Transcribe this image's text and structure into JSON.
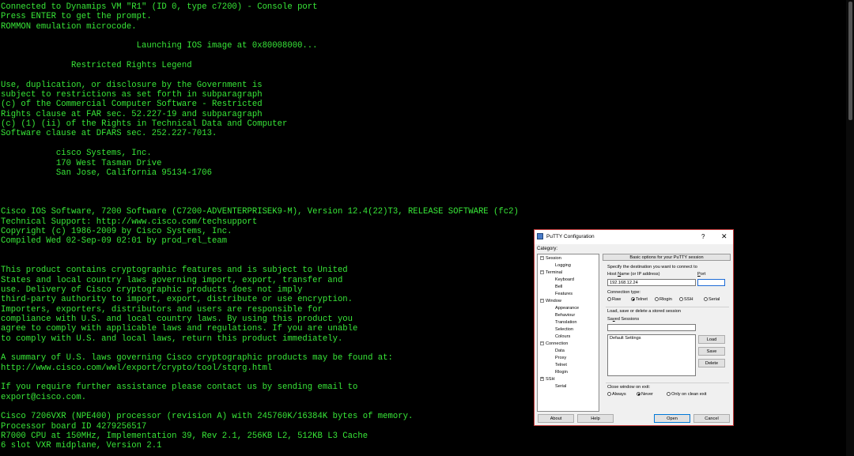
{
  "terminal": {
    "lines": [
      "Connected to Dynamips VM \"R1\" (ID 0, type c7200) - Console port",
      "Press ENTER to get the prompt.",
      "ROMMON emulation microcode.",
      "",
      "                           Launching IOS image at 0x80008000...",
      "",
      "              Restricted Rights Legend",
      "",
      "Use, duplication, or disclosure by the Government is",
      "subject to restrictions as set forth in subparagraph",
      "(c) of the Commercial Computer Software - Restricted",
      "Rights clause at FAR sec. 52.227-19 and subparagraph",
      "(c) (1) (ii) of the Rights in Technical Data and Computer",
      "Software clause at DFARS sec. 252.227-7013.",
      "",
      "           cisco Systems, Inc.",
      "           170 West Tasman Drive",
      "           San Jose, California 95134-1706",
      "",
      "",
      "",
      "Cisco IOS Software, 7200 Software (C7200-ADVENTERPRISEK9-M), Version 12.4(22)T3, RELEASE SOFTWARE (fc2)",
      "Technical Support: http://www.cisco.com/techsupport",
      "Copyright (c) 1986-2009 by Cisco Systems, Inc.",
      "Compiled Wed 02-Sep-09 02:01 by prod_rel_team",
      "",
      "",
      "This product contains cryptographic features and is subject to United",
      "States and local country laws governing import, export, transfer and",
      "use. Delivery of Cisco cryptographic products does not imply",
      "third-party authority to import, export, distribute or use encryption.",
      "Importers, exporters, distributors and users are responsible for",
      "compliance with U.S. and local country laws. By using this product you",
      "agree to comply with applicable laws and regulations. If you are unable",
      "to comply with U.S. and local laws, return this product immediately.",
      "",
      "A summary of U.S. laws governing Cisco cryptographic products may be found at:",
      "http://www.cisco.com/wwl/export/crypto/tool/stqrg.html",
      "",
      "If you require further assistance please contact us by sending email to",
      "export@cisco.com.",
      "",
      "Cisco 7206VXR (NPE400) processor (revision A) with 245760K/16384K bytes of memory.",
      "Processor board ID 4279256517",
      "R7000 CPU at 150MHz, Implementation 39, Rev 2.1, 256KB L2, 512KB L3 Cache",
      "6 slot VXR midplane, Version 2.1"
    ],
    "text_color": "#38e838",
    "background": "#000000"
  },
  "putty": {
    "title": "PuTTY Configuration",
    "help": "?",
    "close": "✕",
    "category_label": "Category:",
    "tree": [
      {
        "label": "Session",
        "expander": "−"
      },
      {
        "label": "Logging"
      },
      {
        "label": "Terminal",
        "expander": "−"
      },
      {
        "label": "Keyboard"
      },
      {
        "label": "Bell"
      },
      {
        "label": "Features"
      },
      {
        "label": "Window",
        "expander": "−"
      },
      {
        "label": "Appearance"
      },
      {
        "label": "Behaviour"
      },
      {
        "label": "Translation"
      },
      {
        "label": "Selection"
      },
      {
        "label": "Colours"
      },
      {
        "label": "Connection",
        "expander": "−"
      },
      {
        "label": "Data"
      },
      {
        "label": "Proxy"
      },
      {
        "label": "Telnet"
      },
      {
        "label": "Rlogin"
      },
      {
        "label": "SSH",
        "expander": "+"
      },
      {
        "label": "Serial"
      }
    ],
    "panel_header": "Basic options for your PuTTY session",
    "specify_label": "Specify the destination you want to connect to",
    "host_label": "Host Name (or IP address)",
    "port_label": "Port",
    "host_value": "192.168.12.24",
    "port_value": "",
    "conn_type_label": "Connection type:",
    "conn_types": [
      "Raw",
      "Telnet",
      "Rlogin",
      "SSH",
      "Serial"
    ],
    "conn_selected": "Telnet",
    "sessions_group_label": "Load, save or delete a stored session",
    "saved_sessions_label": "Saved Sessions",
    "saved_session_value": "",
    "sessions": [
      "Default Settings"
    ],
    "load": "Load",
    "save": "Save",
    "delete": "Delete",
    "close_exit_label": "Close window on exit:",
    "close_options": [
      "Always",
      "Never",
      "Only on clean exit"
    ],
    "close_selected": "Never",
    "about": "About",
    "helpbtn": "Help",
    "open": "Open",
    "cancel": "Cancel",
    "border_color": "#c23a3a"
  }
}
